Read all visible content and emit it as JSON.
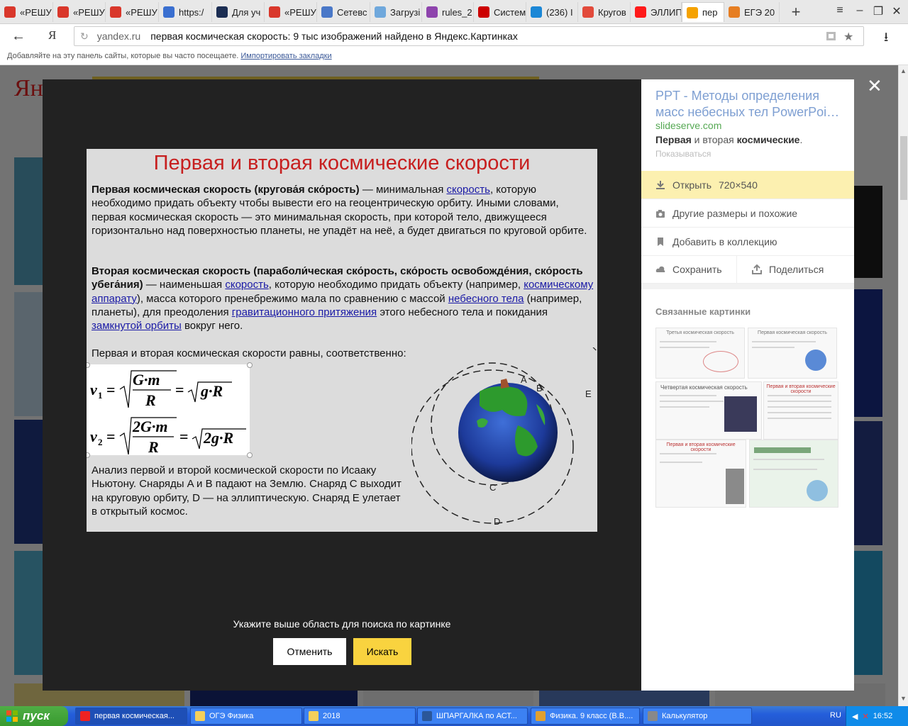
{
  "tabs": [
    {
      "label": "«РЕШУ",
      "color": "#d9372b",
      "icon": "reshu-icon"
    },
    {
      "label": "«РЕШУ",
      "color": "#d9372b",
      "icon": "reshu-icon"
    },
    {
      "label": "«РЕШУ",
      "color": "#d9372b",
      "icon": "reshu-icon"
    },
    {
      "label": "https:/",
      "color": "#3a6fd0",
      "icon": "globe-icon"
    },
    {
      "label": "Для уч",
      "color": "#1b2d52",
      "icon": "space-icon"
    },
    {
      "label": "«РЕШУ",
      "color": "#d9372b",
      "icon": "reshu-icon"
    },
    {
      "label": "Сетевс",
      "color": "#4a78c8",
      "icon": "netschool-icon"
    },
    {
      "label": "Загрузі",
      "color": "#6fa8dc",
      "icon": "google-drive-icon"
    },
    {
      "label": "rules_2",
      "color": "#8e44ad",
      "icon": "doc-icon"
    },
    {
      "label": "Систем",
      "color": "#cc0000",
      "icon": "yandex-icon"
    },
    {
      "label": "(236) I",
      "color": "#1b87d6",
      "icon": "chat-icon"
    },
    {
      "label": "Кругов",
      "color": "#e24a3b",
      "icon": "google-icon"
    },
    {
      "label": "ЭЛЛИП",
      "color": "#ff1a1a",
      "icon": "yandex-icon"
    },
    {
      "label": "пер",
      "color": "#f5a200",
      "icon": "images-icon"
    },
    {
      "label": "ЕГЭ 20",
      "color": "#e67e22",
      "icon": "ege-icon"
    }
  ],
  "browser": {
    "domain": "yandex.ru",
    "page_title": "первая космическая скорость: 9 тыс изображений найдено в Яндекс.Картинках",
    "yandex_button": "Я",
    "bookmarks_hint": "Добавляйте на эту панель сайты, которые вы часто посещаете.",
    "bookmarks_link": "Импортировать закладки"
  },
  "slide": {
    "title": "Первая и вторая космические скорости",
    "p1_bold": "Первая космическая скорость (кругова́я ско́рость)",
    "p1_a": " — минимальная ",
    "p1_link": "скорость",
    "p1_b": ", которую необходимо придать объекту чтобы вывести его на геоцентрическую орбиту. Иными словами, первая космическая скорость — это минимальная скорость, при которой тело, движущееся горизонтально над поверхностью планеты, не упадёт на неё, а будет двигаться по круговой орбите.",
    "p2_bold": "Вторая космическая скорость (параболи́ческая ско́рость, ско́рость освобожде́ния, ско́рость убега́ния)",
    "p2_a": " — наименьшая ",
    "p2_link1": "скорость",
    "p2_b": ", которую необходимо придать объекту (например, ",
    "p2_link2": "космическому аппарату",
    "p2_c": "), масса которого пренебрежимо мала по сравнению с массой ",
    "p2_link3": "небесного тела",
    "p2_d": " (например, планеты), для преодоления ",
    "p2_link4": "гравитационного притяжения",
    "p2_e": " этого небесного тела и покидания ",
    "p2_link5": "замкнутой орбиты",
    "p2_f": " вокруг него.",
    "p3": "Первая и вторая космическая скорости равны, соответственно:",
    "p4": "Анализ первой и второй космической скорости по Исааку Ньютону. Снаряды A и B падают на Землю. Снаряд C выходит на круговую орбиту, D — на эллиптическую. Снаряд E улетает в открытый космос.",
    "diagram_labels": [
      "A",
      "B",
      "C",
      "D",
      "E"
    ]
  },
  "viewer": {
    "hint": "Укажите выше область для поиска по картинке",
    "cancel": "Отменить",
    "search": "Искать"
  },
  "side": {
    "title": "PPT - Методы определения масс небесных тел PowerPoi…",
    "domain": "slideserve.com",
    "desc_bold1": "Первая",
    "desc_mid": " и вторая ",
    "desc_bold2": "космические",
    "desc_end": ".",
    "more": "Показываться",
    "open_label": "Открыть",
    "open_size": "720×540",
    "other_sizes": "Другие размеры и похожие",
    "add_collection": "Добавить в коллекцию",
    "save": "Сохранить",
    "share": "Поделиться",
    "related": "Связанные картинки",
    "related_titles": [
      "Третья космическая скорость",
      "Первая космическая скорость",
      "Четвертая космическая скорость",
      "Первая и вторая космические скорости",
      "Первая и вторая космические скорости",
      ""
    ]
  },
  "taskbar": {
    "start": "пуск",
    "items": [
      {
        "label": "первая космическая...",
        "icon": "yandex-browser-icon",
        "active": true
      },
      {
        "label": "ОГЭ Физика",
        "icon": "folder-icon",
        "active": false
      },
      {
        "label": "2018",
        "icon": "folder-icon",
        "active": false
      },
      {
        "label": "ШПАРГАЛКА по АСТ...",
        "icon": "word-icon",
        "active": false
      },
      {
        "label": "Физика. 9 класс (В.В....",
        "icon": "djvu-icon",
        "active": false
      },
      {
        "label": "Калькулятор",
        "icon": "calculator-icon",
        "active": false
      }
    ],
    "lang": "RU",
    "clock": "16:52"
  }
}
